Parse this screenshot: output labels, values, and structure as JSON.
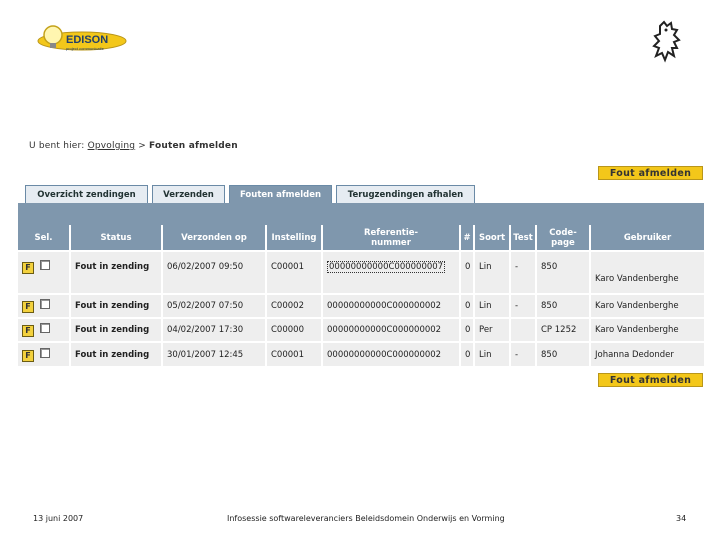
{
  "header": {
    "logo": {
      "text": "EDISON",
      "subtitle": "project communicatie",
      "icon": "lightbulb-icon"
    },
    "emblem": {
      "icon": "flemish-lion-icon"
    }
  },
  "breadcrumb": {
    "prefix": "U bent hier:",
    "link": "Opvolging",
    "separator": ">",
    "current": "Fouten afmelden"
  },
  "buttons": {
    "fout_afmelden_top": "Fout afmelden",
    "fout_afmelden_bottom": "Fout afmelden"
  },
  "tabs": [
    {
      "label": "Overzicht zendingen"
    },
    {
      "label": "Verzenden"
    },
    {
      "label": "Fouten afmelden",
      "active": true
    },
    {
      "label": "Terugzendingen afhalen"
    }
  ],
  "table": {
    "headers": [
      "Sel.",
      "Status",
      "Verzonden op",
      "Instelling",
      "Referentie-\nnummer",
      "#",
      "Soort",
      "Test",
      "Code-\npage",
      "Gebruiker"
    ],
    "rows": [
      {
        "icon": "F",
        "status": "Fout in zending",
        "sent": "06/02/2007 09:50",
        "inst": "C00001",
        "ref": "00000000000C000000007",
        "num": "0",
        "soort": "Lin",
        "test": "-",
        "code": "850",
        "user": "Karo Vandenberghe"
      },
      {
        "icon": "F",
        "status": "Fout in zending",
        "sent": "05/02/2007 07:50",
        "inst": "C00002",
        "ref": "00000000000C000000002",
        "num": "0",
        "soort": "Lin",
        "test": "-",
        "code": "850",
        "user": "Karo Vandenberghe"
      },
      {
        "icon": "F",
        "status": "Fout in zending",
        "sent": "04/02/2007 17:30",
        "inst": "C00000",
        "ref": "00000000000C000000002",
        "num": "0",
        "soort": "Per",
        "test": "",
        "code": "CP 1252",
        "user": "Karo Vandenberghe"
      },
      {
        "icon": "F",
        "status": "Fout in zending",
        "sent": "30/01/2007 12:45",
        "inst": "C00001",
        "ref": "00000000000C000000002",
        "num": "0",
        "soort": "Lin",
        "test": "-",
        "code": "850",
        "user": "Johanna Dedonder"
      }
    ]
  },
  "footer": {
    "date": "13 juni 2007",
    "center": "Infosessie softwareleveranciers Beleidsdomein Onderwijs en Vorming",
    "page": "34"
  }
}
